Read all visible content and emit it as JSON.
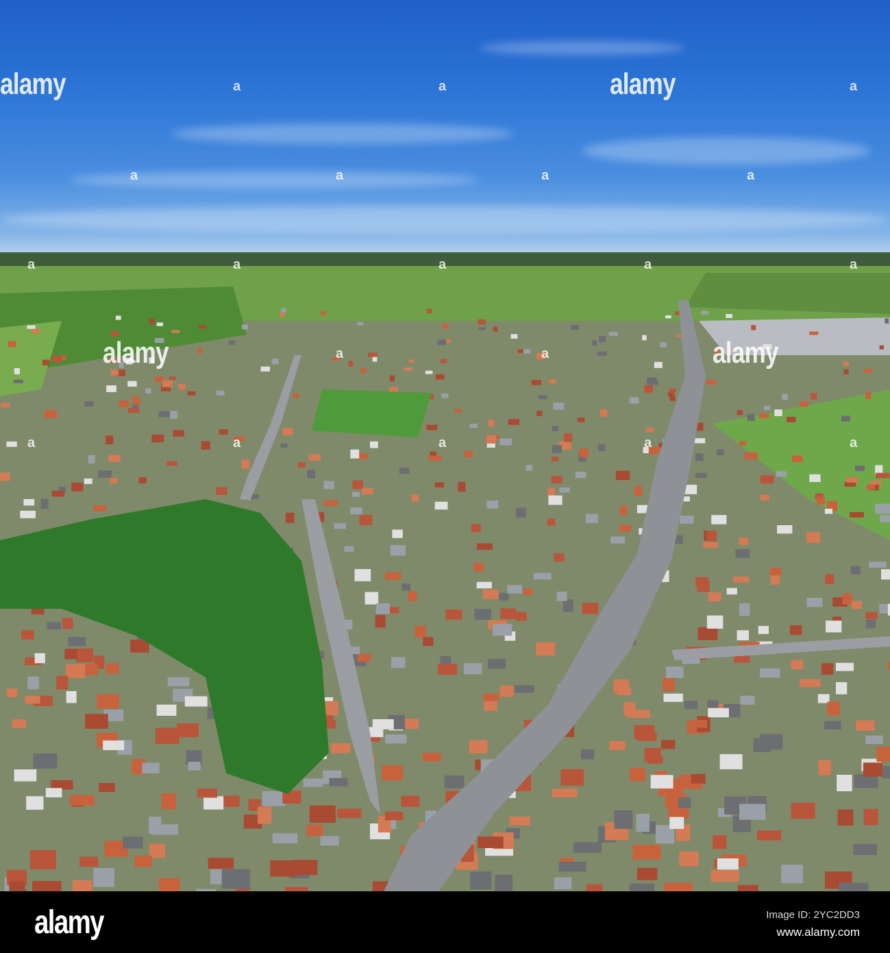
{
  "watermark": {
    "logo_text": "alamy",
    "dot_text": "a"
  },
  "footer": {
    "logo": "alamy",
    "image_id": "Image ID: 2YC2DD3",
    "url": "www.alamy.com"
  },
  "colors": {
    "sky_top": "#1f5fc8",
    "roof": "#c8623d",
    "grass": "#5c9a3c",
    "trees": "#2f7a2a",
    "road": "#8e9196"
  }
}
